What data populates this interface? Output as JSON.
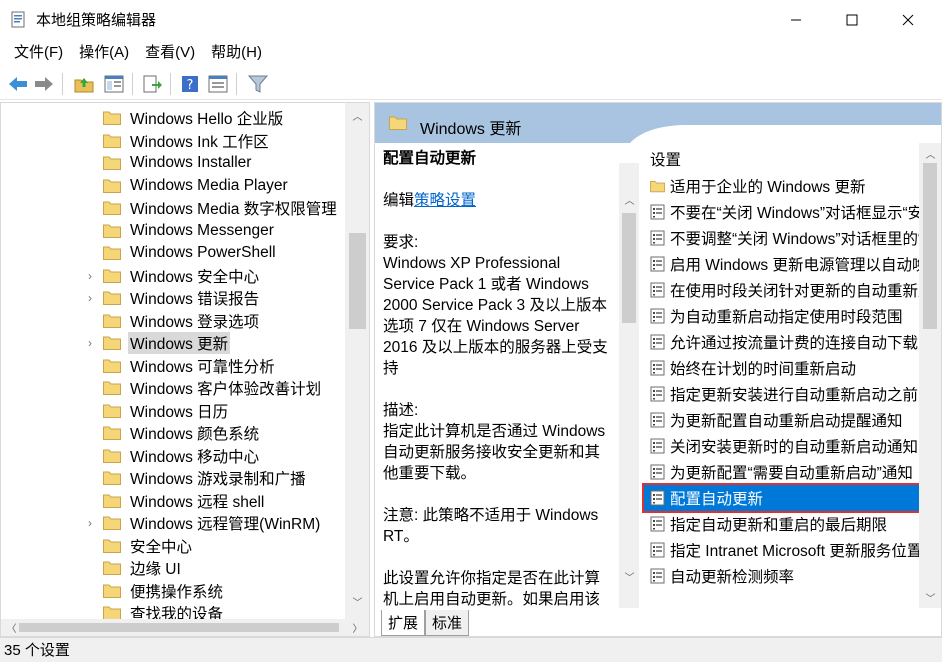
{
  "window": {
    "title": "本地组策略编辑器",
    "minimize_icon": "minimize-icon",
    "maximize_icon": "maximize-icon",
    "close_icon": "close-icon"
  },
  "menu": [
    "文件(F)",
    "操作(A)",
    "查看(V)",
    "帮助(H)"
  ],
  "toolbar": {
    "icons": [
      "back-arrow-icon",
      "forward-arrow-icon",
      "up-folder-icon",
      "show-hide-tree-icon",
      "export-list-icon",
      "help-icon",
      "properties-icon",
      "filter-icon"
    ]
  },
  "tree": {
    "items": [
      {
        "label": "Windows Hello 企业版",
        "expandable": false
      },
      {
        "label": "Windows Ink 工作区",
        "expandable": false
      },
      {
        "label": "Windows Installer",
        "expandable": false
      },
      {
        "label": "Windows Media Player",
        "expandable": false
      },
      {
        "label": "Windows Media 数字权限管理",
        "expandable": false
      },
      {
        "label": "Windows Messenger",
        "expandable": false
      },
      {
        "label": "Windows PowerShell",
        "expandable": false
      },
      {
        "label": "Windows 安全中心",
        "expandable": true
      },
      {
        "label": "Windows 错误报告",
        "expandable": true
      },
      {
        "label": "Windows 登录选项",
        "expandable": false
      },
      {
        "label": "Windows 更新",
        "expandable": true,
        "selected": true
      },
      {
        "label": "Windows 可靠性分析",
        "expandable": false
      },
      {
        "label": "Windows 客户体验改善计划",
        "expandable": false
      },
      {
        "label": "Windows 日历",
        "expandable": false
      },
      {
        "label": "Windows 颜色系统",
        "expandable": false
      },
      {
        "label": "Windows 移动中心",
        "expandable": false
      },
      {
        "label": "Windows 游戏录制和广播",
        "expandable": false
      },
      {
        "label": "Windows 远程 shell",
        "expandable": false
      },
      {
        "label": "Windows 远程管理(WinRM)",
        "expandable": true
      },
      {
        "label": "安全中心",
        "expandable": false
      },
      {
        "label": "边缘 UI",
        "expandable": false
      },
      {
        "label": "便携操作系统",
        "expandable": false
      },
      {
        "label": "查找我的设备",
        "expandable": false
      }
    ]
  },
  "right": {
    "header_title": "Windows 更新",
    "description": {
      "title": "配置自动更新",
      "edit_prefix": "编辑",
      "edit_link": "策略设置",
      "requirements_label": "要求:",
      "requirements": "Windows XP Professional Service Pack 1 或者 Windows 2000 Service Pack 3 及以上版本选项 7 仅在 Windows Server 2016 及以上版本的服务器上受支持",
      "desc_label": "描述:",
      "desc": "指定此计算机是否通过 Windows 自动更新服务接收安全更新和其他重要下载。",
      "note": "注意: 此策略不适用于 Windows RT。",
      "more": "此设置允许你指定是否在此计算机上启用自动更新。如果启用该服"
    },
    "list_header": "设置",
    "settings": [
      {
        "label": "适用于企业的 Windows 更新",
        "icon": "folder-icon"
      },
      {
        "label": "不要在“关闭 Windows”对话框显示“安装",
        "icon": "policy-setting-icon"
      },
      {
        "label": "不要调整“关闭 Windows”对话框里的“安",
        "icon": "policy-setting-icon"
      },
      {
        "label": "启用 Windows 更新电源管理以自动唤醒",
        "icon": "policy-setting-icon"
      },
      {
        "label": "在使用时段关闭针对更新的自动重新启动",
        "icon": "policy-setting-icon"
      },
      {
        "label": "为自动重新启动指定使用时段范围",
        "icon": "policy-setting-icon"
      },
      {
        "label": "允许通过按流量计费的连接自动下载更新",
        "icon": "policy-setting-icon"
      },
      {
        "label": "始终在计划的时间重新启动",
        "icon": "policy-setting-icon"
      },
      {
        "label": "指定更新安装进行自动重新启动之前的期限",
        "icon": "policy-setting-icon"
      },
      {
        "label": "为更新配置自动重新启动提醒通知",
        "icon": "policy-setting-icon"
      },
      {
        "label": "关闭安装更新时的自动重新启动通知",
        "icon": "policy-setting-icon"
      },
      {
        "label": "为更新配置“需要自动重新启动”通知",
        "icon": "policy-setting-icon"
      },
      {
        "label": "配置自动更新",
        "icon": "policy-setting-icon",
        "selected": true
      },
      {
        "label": "指定自动更新和重启的最后期限",
        "icon": "policy-setting-icon"
      },
      {
        "label": "指定 Intranet Microsoft 更新服务位置",
        "icon": "policy-setting-icon"
      },
      {
        "label": "自动更新检测频率",
        "icon": "policy-setting-icon"
      }
    ],
    "tabs": [
      "扩展",
      "标准"
    ]
  },
  "status": "35 个设置"
}
